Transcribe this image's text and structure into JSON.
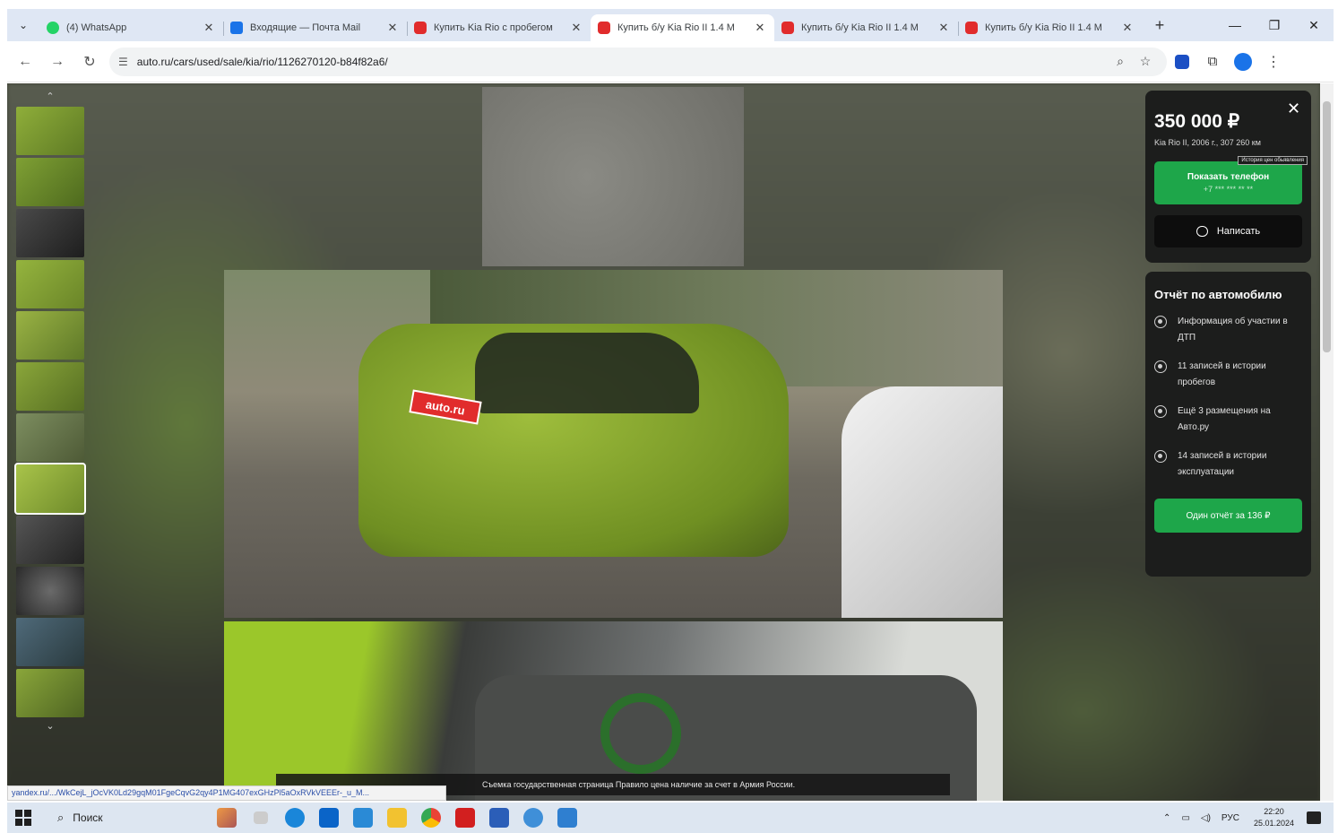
{
  "browser": {
    "tabs": [
      {
        "title": "(4) WhatsApp",
        "favicon": "whatsapp-icon",
        "active": false
      },
      {
        "title": "Входящие — Почта Mail",
        "favicon": "mail-icon",
        "active": false
      },
      {
        "title": "Купить Kia Rio с пробегом",
        "favicon": "autoru-icon",
        "active": false
      },
      {
        "title": "Купить б/у Kia Rio II 1.4 M",
        "favicon": "autoru-icon",
        "active": true
      },
      {
        "title": "Купить б/у Kia Rio II 1.4 M",
        "favicon": "autoru-icon",
        "active": false
      },
      {
        "title": "Купить б/у Kia Rio II 1.4 M",
        "favicon": "autoru-icon",
        "active": false
      }
    ],
    "new_tab": "+",
    "url": "auto.ru/cars/used/sale/kia/rio/1126270120-b84f82a6/",
    "status_url": "yandex.ru/.../WkCejL_jOcVK0Ld29gqM01FgeCqvG2qy4P1MG407exGHzPl5aOxRVkVEEEr-_u_M..."
  },
  "listing": {
    "price": "350 000 ₽",
    "subtitle": "Kia Rio II, 2006 г., 307 260 км",
    "show_phone_label": "Показать телефон",
    "phone_masked": "+7 *** *** ** **",
    "tooltip": "История цен обьявления",
    "write_label": "Написать",
    "plate_text": "auto.ru",
    "report": {
      "title": "Отчёт по автомобилю",
      "items": [
        "Информация об участии в ДТП",
        "11 записей в истории пробегов",
        "Ещё 3 размещения на Авто.ру",
        "14 записей в истории эксплуатации"
      ],
      "button_label": "Один отчёт за 136 ₽"
    },
    "info_bar": "Съемка государственная страница Правило цена наличие за счет в Армия России."
  },
  "taskbar": {
    "search_label": "Поиск",
    "lang": "РУС",
    "time": "22:20",
    "date": "25.01.2024"
  },
  "colors": {
    "accent_green": "#1ea64a",
    "autoru_red": "#e12c2c",
    "panel_dark": "#1c1d1c",
    "car_green": "#8bb232"
  }
}
